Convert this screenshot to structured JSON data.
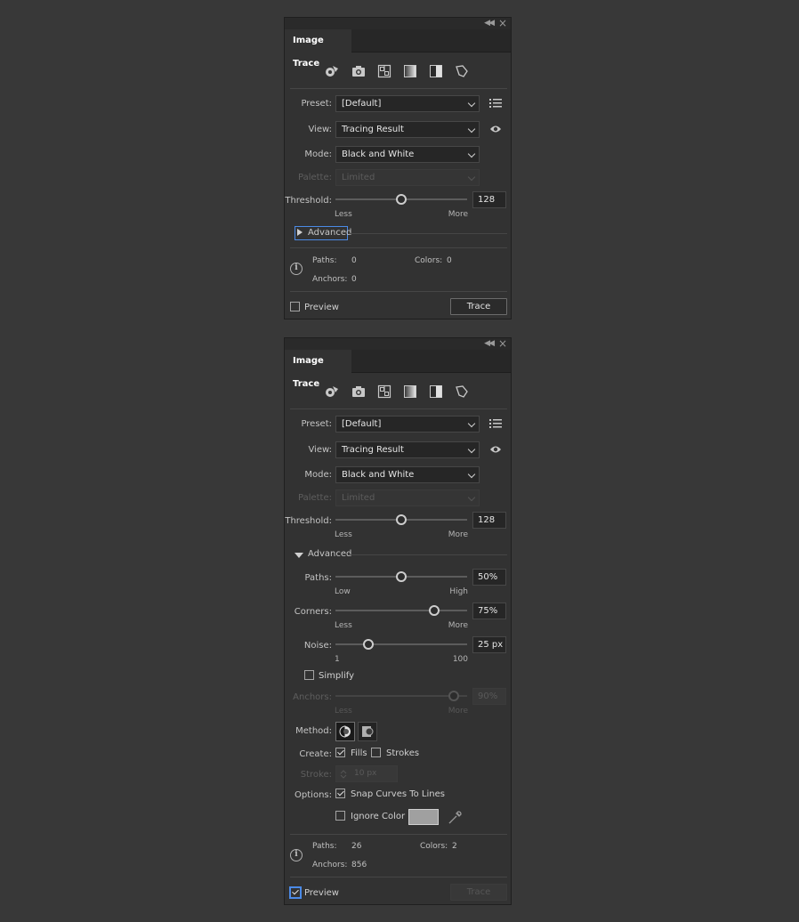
{
  "panel_top": {
    "tab": "Image Trace",
    "preset_label": "Preset:",
    "preset_value": "[Default]",
    "view_label": "View:",
    "view_value": "Tracing Result",
    "mode_label": "Mode:",
    "mode_value": "Black and White",
    "palette_label": "Palette:",
    "palette_value": "Limited",
    "threshold_label": "Threshold:",
    "threshold_value": "128",
    "threshold_level": 0.5,
    "threshold_min": "Less",
    "threshold_max": "More",
    "advanced_label": "Advanced",
    "paths_label": "Paths:",
    "paths_value": "0",
    "colors_label": "Colors:",
    "colors_value": "0",
    "anchors_label": "Anchors:",
    "anchors_value": "0",
    "preview_label": "Preview",
    "preview_checked": false,
    "trace_label": "Trace"
  },
  "panel_bottom": {
    "tab": "Image Trace",
    "preset_label": "Preset:",
    "preset_value": "[Default]",
    "view_label": "View:",
    "view_value": "Tracing Result",
    "mode_label": "Mode:",
    "mode_value": "Black and White",
    "palette_label": "Palette:",
    "palette_value": "Limited",
    "threshold_label": "Threshold:",
    "threshold_value": "128",
    "threshold_level": 0.5,
    "threshold_min": "Less",
    "threshold_max": "More",
    "advanced_label": "Advanced",
    "paths_slider_label": "Paths:",
    "paths_slider_value": "50%",
    "paths_level": 0.5,
    "paths_min": "Low",
    "paths_max": "High",
    "corners_label": "Corners:",
    "corners_value": "75%",
    "corners_level": 0.75,
    "corners_min": "Less",
    "corners_max": "More",
    "noise_label": "Noise:",
    "noise_value": "25 px",
    "noise_level": 0.25,
    "noise_min": "1",
    "noise_max": "100",
    "simplify_label": "Simplify",
    "simplify_checked": false,
    "anchors_slider_label": "Anchors:",
    "anchors_slider_value": "90%",
    "anchors_level": 0.9,
    "anchors_min": "Less",
    "anchors_max": "More",
    "method_label": "Method:",
    "create_label": "Create:",
    "fills_label": "Fills",
    "fills_checked": true,
    "strokes_label": "Strokes",
    "strokes_checked": false,
    "stroke_label": "Stroke:",
    "stroke_value": "10 px",
    "options_label": "Options:",
    "snap_label": "Snap Curves To Lines",
    "snap_checked": true,
    "ignore_label": "Ignore Color",
    "ignore_checked": false,
    "swatch_color": "#a0a0a0",
    "paths_label": "Paths:",
    "paths_value": "26",
    "colors_label": "Colors:",
    "colors_value": "2",
    "anchors_label": "Anchors:",
    "anchors_value": "856",
    "preview_label": "Preview",
    "preview_checked": true,
    "trace_label": "Trace"
  },
  "colors": {
    "accent": "#4b8ae6",
    "panel_bg": "#323232",
    "app_bg": "#383838"
  }
}
